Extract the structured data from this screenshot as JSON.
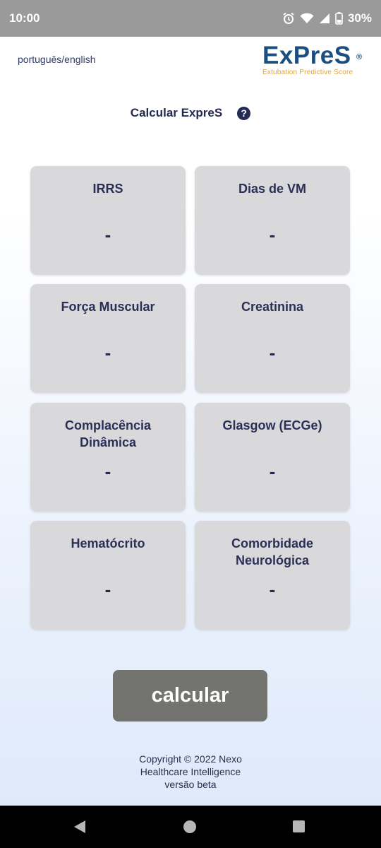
{
  "status_bar": {
    "time": "10:00",
    "battery": "30%",
    "icons": [
      "alarm-icon",
      "wifi-icon",
      "signal-icon",
      "battery-icon"
    ]
  },
  "header": {
    "language_link": "português/english",
    "logo_text": "ExPreS",
    "logo_registered": "®",
    "logo_subtitle": "Extubation Predictive Score"
  },
  "title": {
    "text": "Calcular ExpreS",
    "help_symbol": "?"
  },
  "cards": [
    {
      "label": "IRRS",
      "value": "-"
    },
    {
      "label": "Dias de VM",
      "value": "-"
    },
    {
      "label": "Força Muscular",
      "value": "-"
    },
    {
      "label": "Creatinina",
      "value": "-"
    },
    {
      "label": "Complacência Dinâmica",
      "value": "-"
    },
    {
      "label": "Glasgow (ECGe)",
      "value": "-"
    },
    {
      "label": "Hematócrito",
      "value": "-"
    },
    {
      "label": "Comorbidade Neurológica",
      "value": "-"
    }
  ],
  "calculate_button": "calcular",
  "footer": {
    "line1": "Copyright © 2022 Nexo",
    "line2": "Healthcare Intelligence",
    "line3": "versão beta"
  },
  "colors": {
    "status_bar": "#9a9a9a",
    "card_bg": "#d9d9dc",
    "button_bg": "#737470",
    "logo_blue": "#1c4f7d",
    "logo_orange": "#e0a43a",
    "text_dark": "#24294f"
  }
}
